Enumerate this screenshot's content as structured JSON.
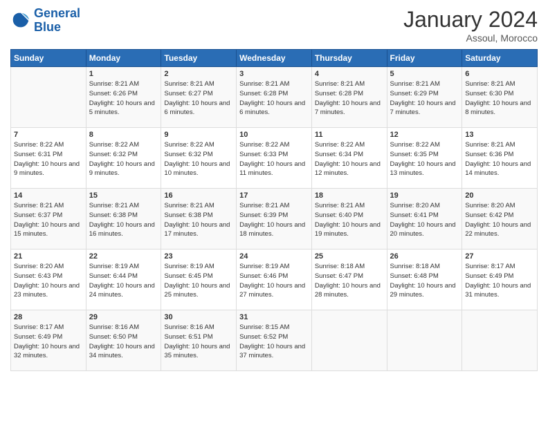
{
  "header": {
    "logo_line1": "General",
    "logo_line2": "Blue",
    "month_title": "January 2024",
    "location": "Assoul, Morocco"
  },
  "weekdays": [
    "Sunday",
    "Monday",
    "Tuesday",
    "Wednesday",
    "Thursday",
    "Friday",
    "Saturday"
  ],
  "weeks": [
    [
      {
        "day": "",
        "sunrise": "",
        "sunset": "",
        "daylight": ""
      },
      {
        "day": "1",
        "sunrise": "Sunrise: 8:21 AM",
        "sunset": "Sunset: 6:26 PM",
        "daylight": "Daylight: 10 hours and 5 minutes."
      },
      {
        "day": "2",
        "sunrise": "Sunrise: 8:21 AM",
        "sunset": "Sunset: 6:27 PM",
        "daylight": "Daylight: 10 hours and 6 minutes."
      },
      {
        "day": "3",
        "sunrise": "Sunrise: 8:21 AM",
        "sunset": "Sunset: 6:28 PM",
        "daylight": "Daylight: 10 hours and 6 minutes."
      },
      {
        "day": "4",
        "sunrise": "Sunrise: 8:21 AM",
        "sunset": "Sunset: 6:28 PM",
        "daylight": "Daylight: 10 hours and 7 minutes."
      },
      {
        "day": "5",
        "sunrise": "Sunrise: 8:21 AM",
        "sunset": "Sunset: 6:29 PM",
        "daylight": "Daylight: 10 hours and 7 minutes."
      },
      {
        "day": "6",
        "sunrise": "Sunrise: 8:21 AM",
        "sunset": "Sunset: 6:30 PM",
        "daylight": "Daylight: 10 hours and 8 minutes."
      }
    ],
    [
      {
        "day": "7",
        "sunrise": "Sunrise: 8:22 AM",
        "sunset": "Sunset: 6:31 PM",
        "daylight": "Daylight: 10 hours and 9 minutes."
      },
      {
        "day": "8",
        "sunrise": "Sunrise: 8:22 AM",
        "sunset": "Sunset: 6:32 PM",
        "daylight": "Daylight: 10 hours and 9 minutes."
      },
      {
        "day": "9",
        "sunrise": "Sunrise: 8:22 AM",
        "sunset": "Sunset: 6:32 PM",
        "daylight": "Daylight: 10 hours and 10 minutes."
      },
      {
        "day": "10",
        "sunrise": "Sunrise: 8:22 AM",
        "sunset": "Sunset: 6:33 PM",
        "daylight": "Daylight: 10 hours and 11 minutes."
      },
      {
        "day": "11",
        "sunrise": "Sunrise: 8:22 AM",
        "sunset": "Sunset: 6:34 PM",
        "daylight": "Daylight: 10 hours and 12 minutes."
      },
      {
        "day": "12",
        "sunrise": "Sunrise: 8:22 AM",
        "sunset": "Sunset: 6:35 PM",
        "daylight": "Daylight: 10 hours and 13 minutes."
      },
      {
        "day": "13",
        "sunrise": "Sunrise: 8:21 AM",
        "sunset": "Sunset: 6:36 PM",
        "daylight": "Daylight: 10 hours and 14 minutes."
      }
    ],
    [
      {
        "day": "14",
        "sunrise": "Sunrise: 8:21 AM",
        "sunset": "Sunset: 6:37 PM",
        "daylight": "Daylight: 10 hours and 15 minutes."
      },
      {
        "day": "15",
        "sunrise": "Sunrise: 8:21 AM",
        "sunset": "Sunset: 6:38 PM",
        "daylight": "Daylight: 10 hours and 16 minutes."
      },
      {
        "day": "16",
        "sunrise": "Sunrise: 8:21 AM",
        "sunset": "Sunset: 6:38 PM",
        "daylight": "Daylight: 10 hours and 17 minutes."
      },
      {
        "day": "17",
        "sunrise": "Sunrise: 8:21 AM",
        "sunset": "Sunset: 6:39 PM",
        "daylight": "Daylight: 10 hours and 18 minutes."
      },
      {
        "day": "18",
        "sunrise": "Sunrise: 8:21 AM",
        "sunset": "Sunset: 6:40 PM",
        "daylight": "Daylight: 10 hours and 19 minutes."
      },
      {
        "day": "19",
        "sunrise": "Sunrise: 8:20 AM",
        "sunset": "Sunset: 6:41 PM",
        "daylight": "Daylight: 10 hours and 20 minutes."
      },
      {
        "day": "20",
        "sunrise": "Sunrise: 8:20 AM",
        "sunset": "Sunset: 6:42 PM",
        "daylight": "Daylight: 10 hours and 22 minutes."
      }
    ],
    [
      {
        "day": "21",
        "sunrise": "Sunrise: 8:20 AM",
        "sunset": "Sunset: 6:43 PM",
        "daylight": "Daylight: 10 hours and 23 minutes."
      },
      {
        "day": "22",
        "sunrise": "Sunrise: 8:19 AM",
        "sunset": "Sunset: 6:44 PM",
        "daylight": "Daylight: 10 hours and 24 minutes."
      },
      {
        "day": "23",
        "sunrise": "Sunrise: 8:19 AM",
        "sunset": "Sunset: 6:45 PM",
        "daylight": "Daylight: 10 hours and 25 minutes."
      },
      {
        "day": "24",
        "sunrise": "Sunrise: 8:19 AM",
        "sunset": "Sunset: 6:46 PM",
        "daylight": "Daylight: 10 hours and 27 minutes."
      },
      {
        "day": "25",
        "sunrise": "Sunrise: 8:18 AM",
        "sunset": "Sunset: 6:47 PM",
        "daylight": "Daylight: 10 hours and 28 minutes."
      },
      {
        "day": "26",
        "sunrise": "Sunrise: 8:18 AM",
        "sunset": "Sunset: 6:48 PM",
        "daylight": "Daylight: 10 hours and 29 minutes."
      },
      {
        "day": "27",
        "sunrise": "Sunrise: 8:17 AM",
        "sunset": "Sunset: 6:49 PM",
        "daylight": "Daylight: 10 hours and 31 minutes."
      }
    ],
    [
      {
        "day": "28",
        "sunrise": "Sunrise: 8:17 AM",
        "sunset": "Sunset: 6:49 PM",
        "daylight": "Daylight: 10 hours and 32 minutes."
      },
      {
        "day": "29",
        "sunrise": "Sunrise: 8:16 AM",
        "sunset": "Sunset: 6:50 PM",
        "daylight": "Daylight: 10 hours and 34 minutes."
      },
      {
        "day": "30",
        "sunrise": "Sunrise: 8:16 AM",
        "sunset": "Sunset: 6:51 PM",
        "daylight": "Daylight: 10 hours and 35 minutes."
      },
      {
        "day": "31",
        "sunrise": "Sunrise: 8:15 AM",
        "sunset": "Sunset: 6:52 PM",
        "daylight": "Daylight: 10 hours and 37 minutes."
      },
      {
        "day": "",
        "sunrise": "",
        "sunset": "",
        "daylight": ""
      },
      {
        "day": "",
        "sunrise": "",
        "sunset": "",
        "daylight": ""
      },
      {
        "day": "",
        "sunrise": "",
        "sunset": "",
        "daylight": ""
      }
    ]
  ]
}
